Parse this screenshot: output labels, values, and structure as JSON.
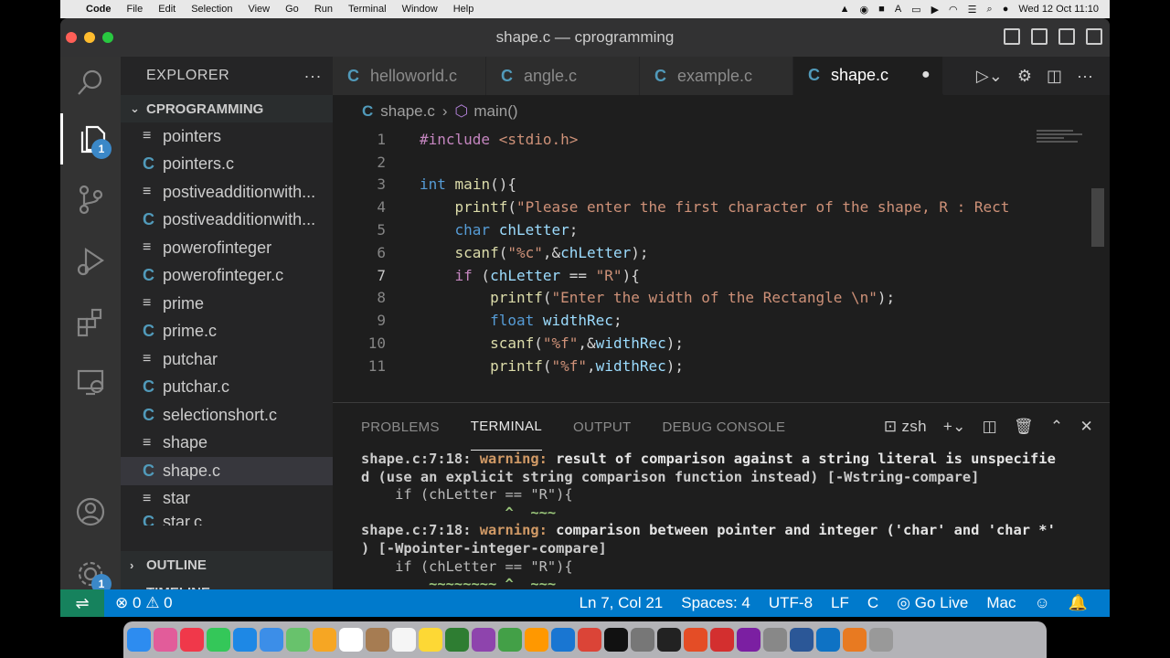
{
  "menubar": {
    "apple": "",
    "app_name": "Code",
    "menus": [
      "File",
      "Edit",
      "Selection",
      "View",
      "Go",
      "Run",
      "Terminal",
      "Window",
      "Help"
    ],
    "clock": "Wed 12 Oct  11:10"
  },
  "window": {
    "title": "shape.c — cprogramming"
  },
  "activity": {
    "explorer_badge": "1",
    "settings_badge": "1"
  },
  "sidebar": {
    "header": "EXPLORER",
    "more": "···",
    "project": "CPROGRAMMING",
    "files": [
      {
        "name": "pointers",
        "type": "bin"
      },
      {
        "name": "pointers.c",
        "type": "c"
      },
      {
        "name": "postiveadditionwith...",
        "type": "bin"
      },
      {
        "name": "postiveadditionwith...",
        "type": "c"
      },
      {
        "name": "powerofinteger",
        "type": "bin"
      },
      {
        "name": "powerofinteger.c",
        "type": "c"
      },
      {
        "name": "prime",
        "type": "bin"
      },
      {
        "name": "prime.c",
        "type": "c"
      },
      {
        "name": "putchar",
        "type": "bin"
      },
      {
        "name": "putchar.c",
        "type": "c"
      },
      {
        "name": "selectionshort.c",
        "type": "c"
      },
      {
        "name": "shape",
        "type": "bin"
      },
      {
        "name": "shape.c",
        "type": "c",
        "selected": true
      },
      {
        "name": "star",
        "type": "bin"
      },
      {
        "name": "star.c",
        "type": "c"
      }
    ],
    "outline": "OUTLINE",
    "timeline": "TIMELINE"
  },
  "tabs": [
    {
      "label": "helloworld.c",
      "icon": "C"
    },
    {
      "label": "angle.c",
      "icon": "C"
    },
    {
      "label": "example.c",
      "icon": "C"
    },
    {
      "label": "shape.c",
      "icon": "C",
      "active": true,
      "modified": "●"
    }
  ],
  "breadcrumb": {
    "file": "shape.c",
    "symbol": "main()"
  },
  "editor": {
    "lines": [
      {
        "n": "1",
        "html": "<span class='k-pre'>#include</span> <span class='k-str'>&lt;stdio.h&gt;</span>"
      },
      {
        "n": "2",
        "html": ""
      },
      {
        "n": "3",
        "html": "<span class='k-type'>int</span> <span class='k-fn'>main</span>(){"
      },
      {
        "n": "4",
        "html": "    <span class='k-fn'>printf</span>(<span class='k-str'>\"Please enter the first character of the shape, R : Rect</span>"
      },
      {
        "n": "5",
        "html": "    <span class='k-type'>char</span> <span class='k-var'>chLetter</span>;"
      },
      {
        "n": "6",
        "html": "    <span class='k-fn'>scanf</span>(<span class='k-str'>\"%c\"</span>,&amp;<span class='k-var'>chLetter</span>);"
      },
      {
        "n": "7",
        "html": "    <span class='k-pre'>if</span> (<span class='k-var'>chLetter</span> == <span class='k-str'>\"R\"</span>){",
        "current": true
      },
      {
        "n": "8",
        "html": "        <span class='k-fn'>printf</span>(<span class='k-str'>\"Enter the width of the Rectangle \\n\"</span>);"
      },
      {
        "n": "9",
        "html": "        <span class='k-type'>float</span> <span class='k-var'>widthRec</span>;"
      },
      {
        "n": "10",
        "html": "        <span class='k-fn'>scanf</span>(<span class='k-str'>\"%f\"</span>,&amp;<span class='k-var'>widthRec</span>);"
      },
      {
        "n": "11",
        "html": "        <span class='k-fn'>printf</span>(<span class='k-str'>\"%f\"</span>,<span class='k-var'>widthRec</span>);"
      }
    ]
  },
  "panel": {
    "tabs": [
      "PROBLEMS",
      "TERMINAL",
      "OUTPUT",
      "DEBUG CONSOLE"
    ],
    "active_tab": "TERMINAL",
    "shell": "zsh",
    "terminal": [
      "shape.c:7:18: warning: result of comparison against a string literal is unspecifie",
      "d (use an explicit string comparison function instead) [-Wstring-compare]",
      "    if (chLetter == \"R\"){",
      "                 ^  ~~~",
      "shape.c:7:18: warning: comparison between pointer and integer ('char' and 'char *'",
      ") [-Wpointer-integer-compare]",
      "    if (chLetter == \"R\"){",
      "        ~~~~~~~~ ^  ~~~"
    ]
  },
  "status": {
    "errors": "0",
    "warnings": "0",
    "position": "Ln 7, Col 21",
    "spaces": "Spaces: 4",
    "encoding": "UTF-8",
    "eol": "LF",
    "language": "C",
    "golive": "Go Live",
    "platform": "Mac"
  }
}
